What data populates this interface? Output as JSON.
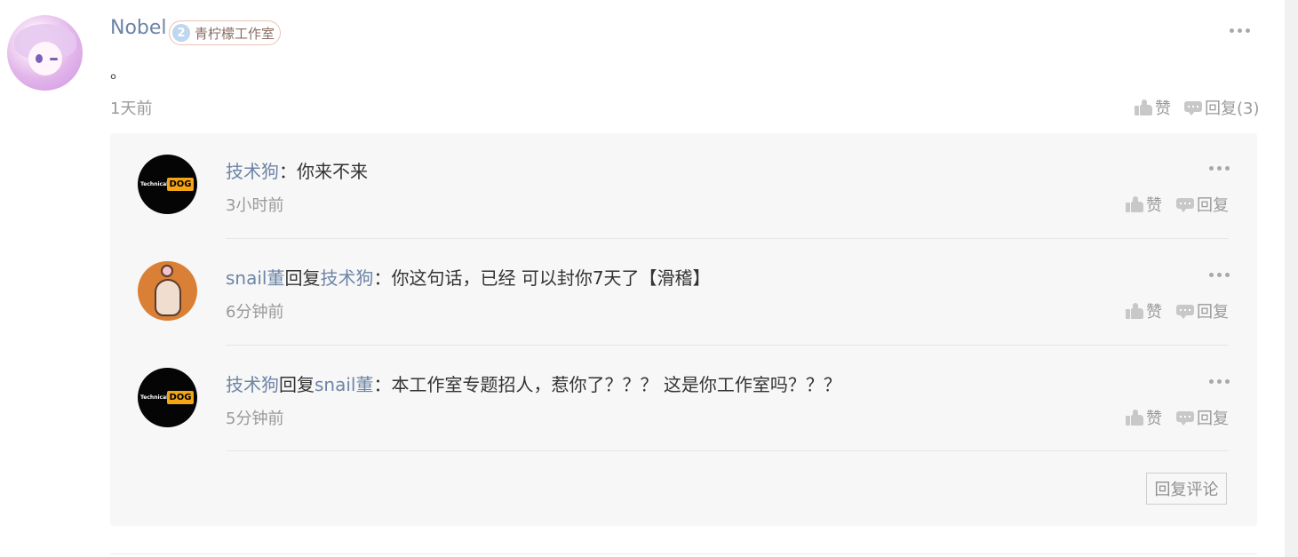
{
  "comment": {
    "username": "Nobel",
    "badge_level": "2",
    "badge_text": "青柠檬工作室",
    "body": "。",
    "time": "1天前",
    "like_label": "赞",
    "reply_label": "回复(3)"
  },
  "replies": [
    {
      "author": "技术狗",
      "reply_word": "",
      "reply_to": "",
      "text": "：你来不来",
      "time": "3小时前",
      "like_label": "赞",
      "reply_label": "回复"
    },
    {
      "author": "snail董",
      "reply_word": "回复",
      "reply_to": "技术狗",
      "text": "：你这句话，已经 可以封你7天了【滑稽】",
      "time": "6分钟前",
      "like_label": "赞",
      "reply_label": "回复"
    },
    {
      "author": "技术狗",
      "reply_word": "回复",
      "reply_to": "snail董",
      "text": "：本工作室专题招人，惹你了？？？ 这是你工作室吗？？？",
      "time": "5分钟前",
      "like_label": "赞",
      "reply_label": "回复"
    }
  ],
  "avatar_text": {
    "dog_small": "Technical",
    "dog_tag": "DOG"
  },
  "reply_comment_button": "回复评论",
  "icons": {
    "like": "thumbs-up-icon",
    "reply": "speech-bubble-icon",
    "more": "more-dots-icon"
  },
  "colors": {
    "name_link": "#6d84a6",
    "muted": "#9a9a9a",
    "panel_bg": "#f7f7f7"
  }
}
